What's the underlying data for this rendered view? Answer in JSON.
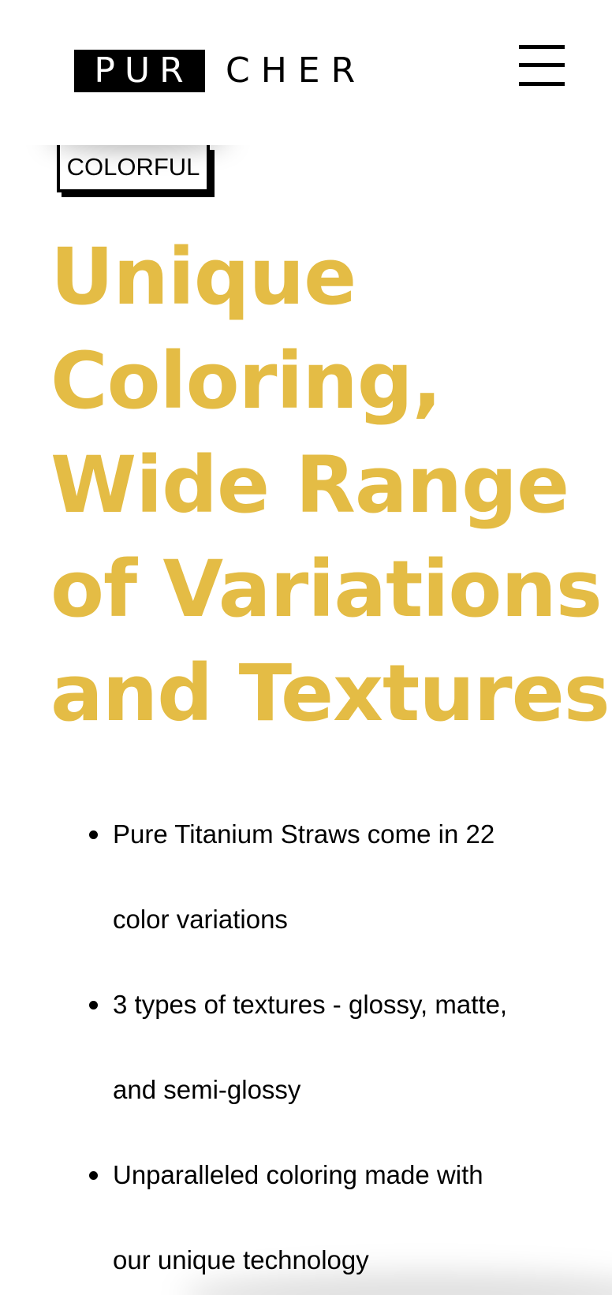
{
  "header": {
    "logo_boxed": "PUR",
    "logo_rest": "CHER",
    "menu_icon": "hamburger-menu-icon"
  },
  "tag": {
    "label": "COLORFUL"
  },
  "headline": {
    "lines": [
      "Unique",
      "Coloring,",
      "Wide Range",
      "of Variations",
      "and Textures"
    ]
  },
  "features": [
    {
      "lines": [
        "Pure Titanium Straws come in 22",
        "color variations"
      ]
    },
    {
      "lines": [
        "3 types of textures - glossy, matte,",
        "and semi-glossy"
      ]
    },
    {
      "lines": [
        "Unparalleled coloring made with",
        "our unique technology"
      ]
    }
  ],
  "colors": {
    "accent": "#e4bc45",
    "text": "#000000",
    "background": "#ffffff"
  }
}
